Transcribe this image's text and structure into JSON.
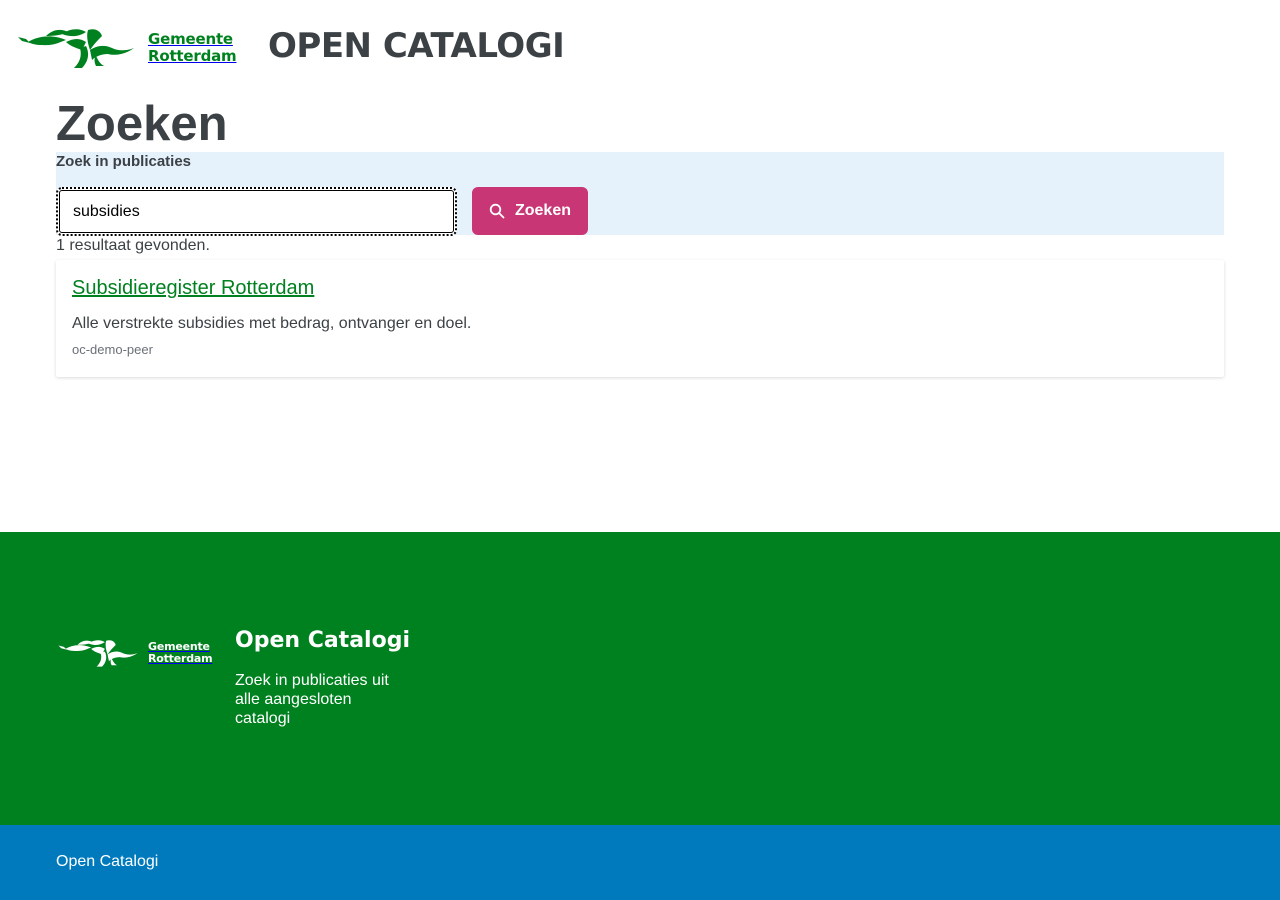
{
  "header": {
    "logo_line1": "Gemeente",
    "logo_line2": "Rotterdam",
    "site_title": "OPEN CATALOGI"
  },
  "main": {
    "page_title": "Zoeken",
    "search": {
      "label": "Zoek in publicaties",
      "value": "subsidies",
      "button_label": "Zoeken",
      "button_color": "#c93675"
    },
    "result_count": "1 resultaat gevonden.",
    "results": [
      {
        "title": "Subsidieregister Rotterdam",
        "description": "Alle verstrekte subsidies met bedrag, ontvanger en doel.",
        "catalog": "oc-demo-peer"
      }
    ]
  },
  "footer": {
    "logo_line1": "Gemeente",
    "logo_line2": "Rotterdam",
    "title": "Open Catalogi",
    "description": "Zoek in publicaties uit alle aangesloten catalogi",
    "bottom_text": "Open Catalogi",
    "colors": {
      "main": "#00811f",
      "bottom": "#0079bd"
    }
  },
  "icons": {
    "search_button": "search-icon",
    "logo": "rotterdam-lion-logo-icon"
  }
}
